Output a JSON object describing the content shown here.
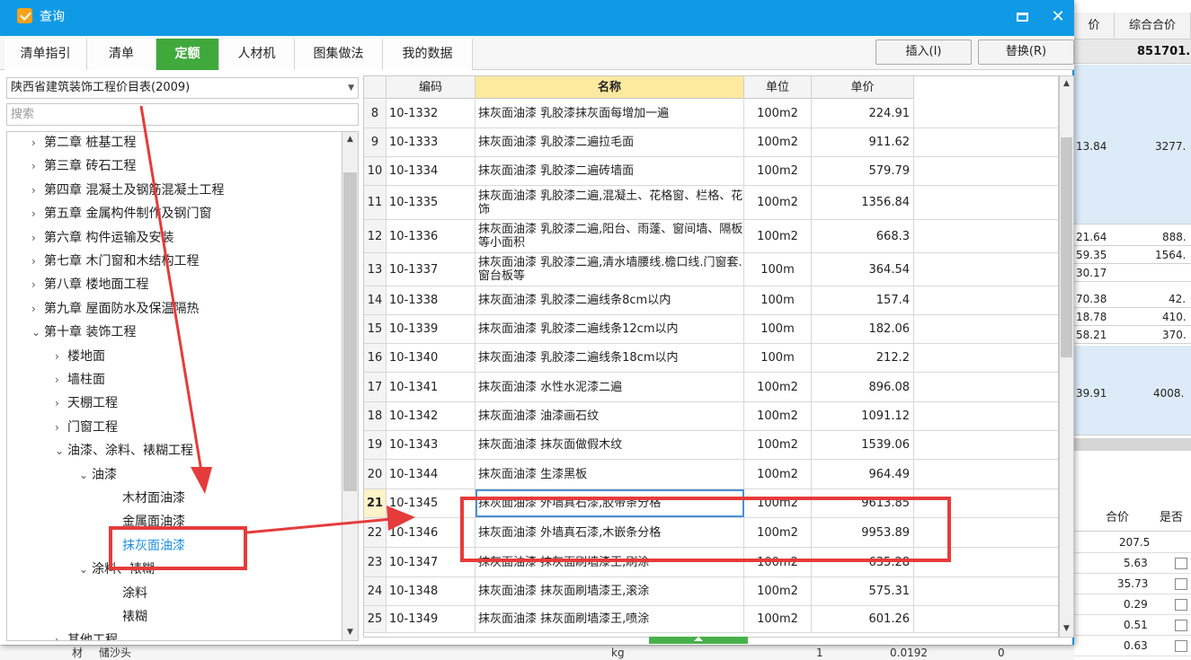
{
  "dialog": {
    "title": "查询",
    "tabs": [
      {
        "label": "清单指引"
      },
      {
        "label": "清单"
      },
      {
        "label": "定额"
      },
      {
        "label": "人材机"
      },
      {
        "label": "图集做法"
      },
      {
        "label": "我的数据"
      }
    ],
    "active_tab": "定额",
    "insert_label": "插入(I)",
    "replace_label": "替换(R)"
  },
  "left": {
    "library": "陕西省建筑装饰工程价目表(2009)",
    "search_placeholder": "搜索",
    "tree": [
      {
        "label": "第二章 桩基工程",
        "arrow": "›",
        "level": 1
      },
      {
        "label": "第三章 砖石工程",
        "arrow": "›",
        "level": 1
      },
      {
        "label": "第四章 混凝土及钢筋混凝土工程",
        "arrow": "›",
        "level": 1
      },
      {
        "label": "第五章 金属构件制作及钢门窗",
        "arrow": "›",
        "level": 1
      },
      {
        "label": "第六章 构件运输及安装",
        "arrow": "›",
        "level": 1
      },
      {
        "label": "第七章 木门窗和木结构工程",
        "arrow": "›",
        "level": 1
      },
      {
        "label": "第八章 楼地面工程",
        "arrow": "›",
        "level": 1
      },
      {
        "label": "第九章 屋面防水及保温隔热",
        "arrow": "›",
        "level": 1
      },
      {
        "label": "第十章 装饰工程",
        "arrow": "⌄",
        "level": 1
      },
      {
        "label": "楼地面",
        "arrow": "›",
        "level": 2
      },
      {
        "label": "墙柱面",
        "arrow": "›",
        "level": 2
      },
      {
        "label": "天棚工程",
        "arrow": "›",
        "level": 2
      },
      {
        "label": "门窗工程",
        "arrow": "›",
        "level": 2
      },
      {
        "label": "油漆、涂料、裱糊工程",
        "arrow": "⌄",
        "level": 2
      },
      {
        "label": "油漆",
        "arrow": "⌄",
        "level": 3
      },
      {
        "label": "木材面油漆",
        "arrow": "",
        "level": 4
      },
      {
        "label": "金属面油漆",
        "arrow": "",
        "level": 4
      },
      {
        "label": "抹灰面油漆",
        "arrow": "",
        "level": 4,
        "selected": true
      },
      {
        "label": "涂料、裱糊",
        "arrow": "⌄",
        "level": 3
      },
      {
        "label": "涂料",
        "arrow": "",
        "level": 4
      },
      {
        "label": "裱糊",
        "arrow": "",
        "level": 4
      },
      {
        "label": "其他工程",
        "arrow": "›",
        "level": 2
      }
    ]
  },
  "grid": {
    "headers": {
      "code": "编码",
      "name": "名称",
      "unit": "单位",
      "price": "单价"
    },
    "rows": [
      {
        "no": "8",
        "code": "10-1332",
        "name": "抹灰面油漆 乳胶漆抹灰面每增加一遍",
        "unit": "100m2",
        "price": "224.91"
      },
      {
        "no": "9",
        "code": "10-1333",
        "name": "抹灰面油漆 乳胶漆二遍拉毛面",
        "unit": "100m2",
        "price": "911.62"
      },
      {
        "no": "10",
        "code": "10-1334",
        "name": "抹灰面油漆 乳胶漆二遍砖墙面",
        "unit": "100m2",
        "price": "579.79"
      },
      {
        "no": "11",
        "code": "10-1335",
        "name": "抹灰面油漆 乳胶漆二遍,混凝土、花格窗、栏格、花饰",
        "unit": "100m2",
        "price": "1356.84"
      },
      {
        "no": "12",
        "code": "10-1336",
        "name": "抹灰面油漆 乳胶漆二遍,阳台、雨蓬、窗间墙、隔板等小面积",
        "unit": "100m2",
        "price": "668.3"
      },
      {
        "no": "13",
        "code": "10-1337",
        "name": "抹灰面油漆 乳胶漆二遍,清水墙腰线.檐口线.门窗套.窗台板等",
        "unit": "100m",
        "price": "364.54"
      },
      {
        "no": "14",
        "code": "10-1338",
        "name": "抹灰面油漆 乳胶漆二遍线条8cm以内",
        "unit": "100m",
        "price": "157.4"
      },
      {
        "no": "15",
        "code": "10-1339",
        "name": "抹灰面油漆 乳胶漆二遍线条12cm以内",
        "unit": "100m",
        "price": "182.06"
      },
      {
        "no": "16",
        "code": "10-1340",
        "name": "抹灰面油漆 乳胶漆二遍线条18cm以内",
        "unit": "100m",
        "price": "212.2"
      },
      {
        "no": "17",
        "code": "10-1341",
        "name": "抹灰面油漆 水性水泥漆二遍",
        "unit": "100m2",
        "price": "896.08"
      },
      {
        "no": "18",
        "code": "10-1342",
        "name": "抹灰面油漆 油漆画石纹",
        "unit": "100m2",
        "price": "1091.12"
      },
      {
        "no": "19",
        "code": "10-1343",
        "name": "抹灰面油漆 抹灰面做假木纹",
        "unit": "100m2",
        "price": "1539.06"
      },
      {
        "no": "20",
        "code": "10-1344",
        "name": "抹灰面油漆 生漆黑板",
        "unit": "100m2",
        "price": "964.49"
      },
      {
        "no": "21",
        "code": "10-1345",
        "name": "抹灰面油漆 外墙真石漆,胶带条分格",
        "unit": "100m2",
        "price": "9613.85",
        "current": true
      },
      {
        "no": "22",
        "code": "10-1346",
        "name": "抹灰面油漆 外墙真石漆,木嵌条分格",
        "unit": "100m2",
        "price": "9953.89"
      },
      {
        "no": "23",
        "code": "10-1347",
        "name": "抹灰面油漆 抹灰面刷墙漆王,刷涂",
        "unit": "100m2",
        "price": "635.28"
      },
      {
        "no": "24",
        "code": "10-1348",
        "name": "抹灰面油漆 抹灰面刷墙漆王,滚涂",
        "unit": "100m2",
        "price": "575.31"
      },
      {
        "no": "25",
        "code": "10-1349",
        "name": "抹灰面油漆 抹灰面刷墙漆王,喷涂",
        "unit": "100m2",
        "price": "601.26"
      }
    ]
  },
  "background": {
    "col_price": "价",
    "col_total": "综合合价",
    "grand_total": "851701.",
    "rows": [
      {
        "a": "13.84",
        "b": "3277."
      },
      {
        "a": "21.64",
        "b": "888."
      },
      {
        "a": "59.35",
        "b": "1564."
      },
      {
        "a": "30.17",
        "b": ""
      },
      {
        "a": "70.38",
        "b": "42."
      },
      {
        "a": "18.78",
        "b": "410."
      },
      {
        "a": "58.21",
        "b": "370."
      },
      {
        "a": "39.91",
        "b": "4008."
      }
    ],
    "lower_h1": "合价",
    "lower_h2": "是否",
    "lower_rows": [
      "207.5",
      "5.63",
      "35.73",
      "0.29",
      "0.51",
      "0.63"
    ],
    "strip_left": "材",
    "strip_name": "储沙头",
    "strip_unit": "kg",
    "strip_qty": "1",
    "strip_val": "0.0192",
    "strip_z": "0"
  },
  "colors": {
    "title_bar": "#109ae5",
    "active_tab": "#40a93c",
    "annotation": "#e63b3b",
    "selected_node": "#1e8fe0"
  }
}
